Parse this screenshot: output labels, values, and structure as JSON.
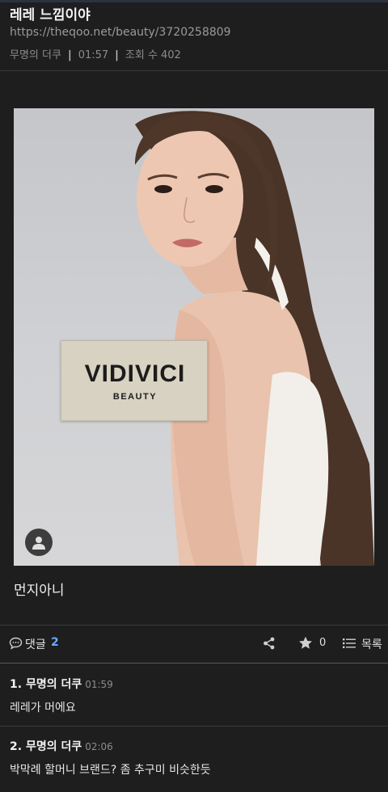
{
  "post": {
    "title": "레레 느낌이야",
    "url": "https://theqoo.net/beauty/3720258809",
    "author": "무명의 더쿠",
    "time": "01:57",
    "views_label": "조회 수 402",
    "separator": "|",
    "body": "먼지아니"
  },
  "image": {
    "brand_logo": "VIDIVICI",
    "brand_sub": "BEAUTY",
    "avatar_icon": "person-icon"
  },
  "actions": {
    "comment_label": "댓글",
    "comment_count": "2",
    "share_icon": "share-icon",
    "star_count": "0",
    "list_label": "목록"
  },
  "comments": [
    {
      "num": "1.",
      "author": "무명의 더쿠",
      "time": "01:59",
      "text": "레레가 머에요"
    },
    {
      "num": "2.",
      "author": "무명의 더쿠",
      "time": "02:06",
      "text": "박막례 할머니 브랜드? 좀 추구미 비슷한듯"
    }
  ],
  "colors": {
    "background": "#1e1e1e",
    "accent_count": "#6fa8ff",
    "divider": "#3a3a3a"
  }
}
